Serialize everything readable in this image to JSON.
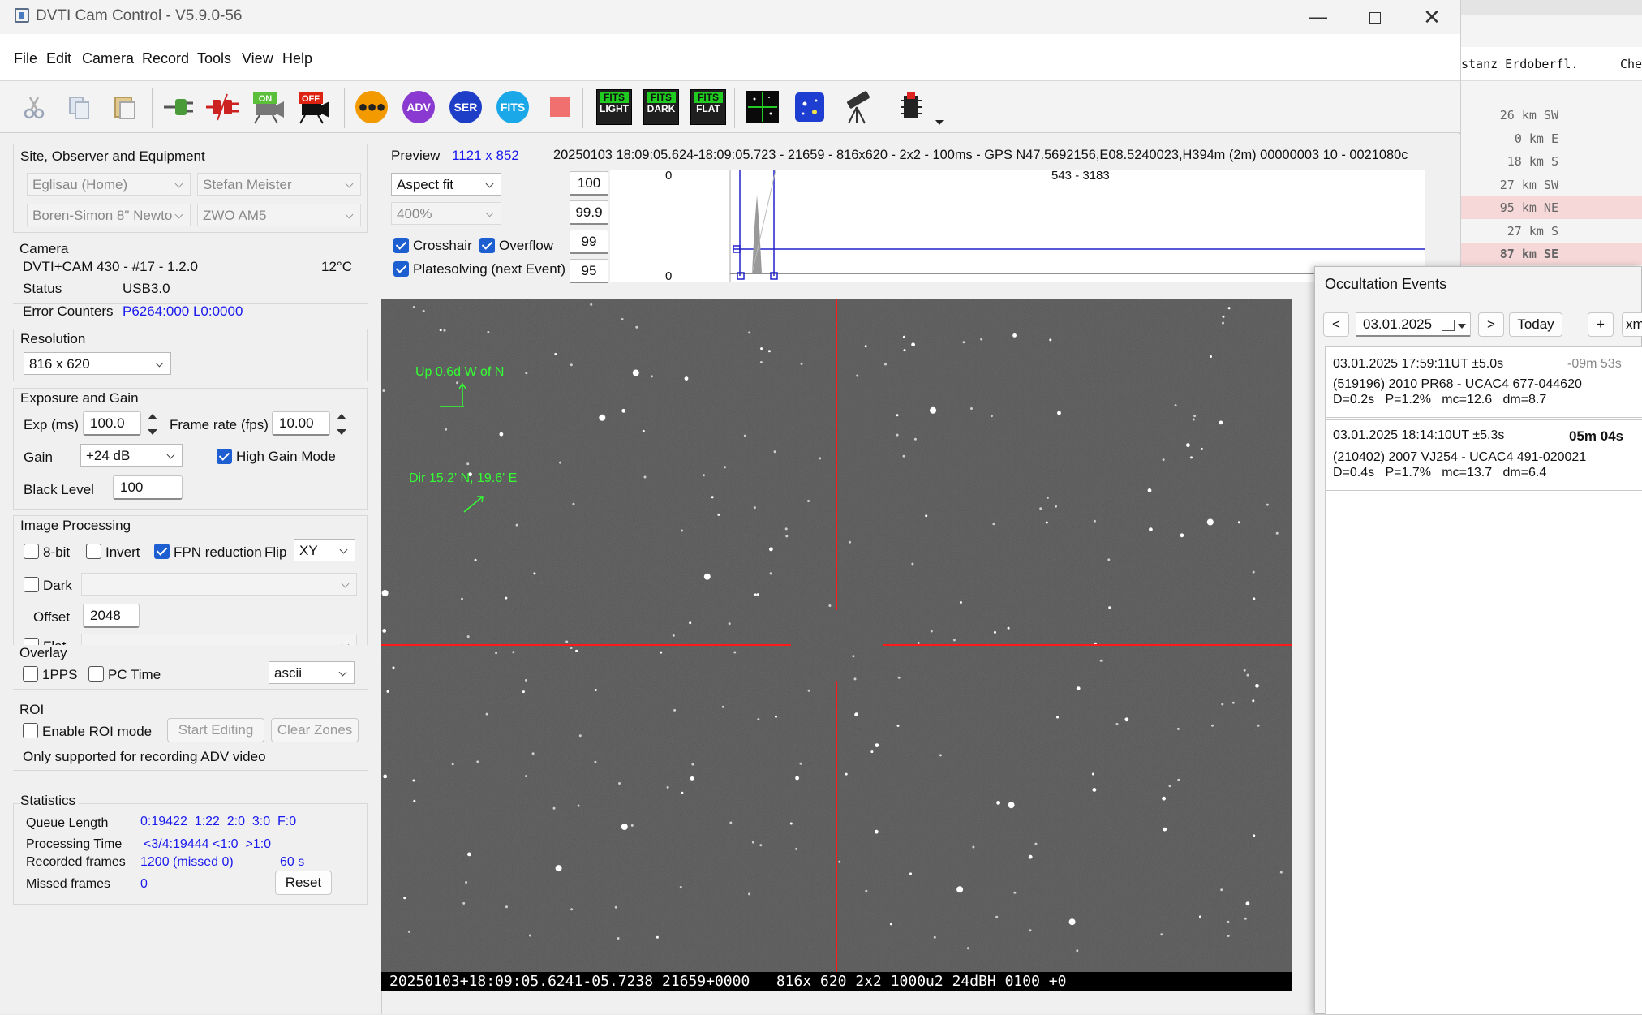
{
  "window": {
    "title": "DVTI Cam Control - V5.9.0-56"
  },
  "menu": [
    "File",
    "Edit",
    "Camera",
    "Record",
    "Tools",
    "View",
    "Help"
  ],
  "toolbar": {
    "adv": "ADV",
    "ser": "SER",
    "fits": "FITS",
    "on": "ON",
    "off": "OFF",
    "fits_light": [
      "FITS",
      "LIGHT"
    ],
    "fits_dark": [
      "FITS",
      "DARK"
    ],
    "fits_flat": [
      "FITS",
      "FLAT"
    ]
  },
  "site": {
    "title": "Site, Observer and Equipment",
    "site": "Eglisau (Home)",
    "observer": "Stefan Meister",
    "telescope": "Boren-Simon 8\" Newto",
    "camera_model": "ZWO AM5"
  },
  "camera": {
    "title": "Camera",
    "model": "DVTI+CAM 430  -  #17  -  1.2.0",
    "temp": "12°C",
    "status_label": "Status",
    "status": "USB3.0",
    "err_label": "Error Counters",
    "errors": "P6264:000 L0:0000"
  },
  "resolution": {
    "title": "Resolution",
    "value": "816 x 620"
  },
  "exposure": {
    "title": "Exposure and Gain",
    "exp_label": "Exp (ms)",
    "exp": "100.0",
    "fps_label": "Frame rate (fps)",
    "fps": "10.00",
    "gain_label": "Gain",
    "gain": "+24 dB",
    "high_gain": "High Gain Mode",
    "black_label": "Black Level",
    "black": "100"
  },
  "imgproc": {
    "title": "Image Processing",
    "bit8": "8-bit",
    "invert": "Invert",
    "fpn": "FPN reduction",
    "flip_label": "Flip",
    "flip": "XY",
    "dark": "Dark",
    "offset_label": "Offset",
    "offset": "2048",
    "flat": "Flat"
  },
  "overlay": {
    "title": "Overlay",
    "pps": "1PPS",
    "pctime": "PC Time",
    "mode": "ascii"
  },
  "roi": {
    "title": "ROI",
    "enable": "Enable ROI mode",
    "start": "Start Editing",
    "clear": "Clear Zones",
    "note": "Only supported for recording ADV video"
  },
  "stats": {
    "title": "Statistics",
    "queue_label": "Queue Length",
    "queue": "0:19422  1:22  2:0  3:0  F:0",
    "proc_label": "Processing Time",
    "proc": "<3/4:19444 <1:0  >1:0",
    "rec_label": "Recorded frames",
    "rec": "1200 (missed 0)",
    "rec_time": "60 s",
    "missed_label": "Missed frames",
    "missed": "0",
    "reset": "Reset"
  },
  "preview": {
    "label": "Preview",
    "size": "1121 x 852",
    "info": "20250103 18:09:05.624-18:09:05.723 - 21659 - 816x620 - 2x2 - 100ms - GPS N47.5692156,E08.5240023,H394m (2m) 00000003 10 - 0021080c",
    "fit": "Aspect fit",
    "zoom": "400%",
    "v1": "100",
    "v2": "99.9",
    "v3": "99",
    "v4": "95",
    "crosshair": "Crosshair",
    "overflow": "Overflow",
    "platesolving": "Platesolving (next Event)",
    "hist_top": "0",
    "hist_bottom": "0",
    "hist_range": "543 - 3183"
  },
  "image": {
    "up": "Up 0.6d W of N",
    "dir": "Dir 15.2' N, 19.6' E",
    "footer": "20250103+18:09:05.6241-05.7238 21659+0000   816x 620 2x2 1000u2 24dBH 0100 +0"
  },
  "occ": {
    "title": "Occultation Events",
    "prev": "<",
    "date": "03.01.2025",
    "next": ">",
    "today": "Today",
    "plus": "+",
    "xm": "xm",
    "events": [
      {
        "time": "03.01.2025 17:59:11UT ±5.0s",
        "countdown": "-09m 53s",
        "name": "(519196) 2010 PR68 - UCAC4 677-044620",
        "details": "D=0.2s   P=1.2%   mc=12.6   dm=8.7"
      },
      {
        "time": "03.01.2025 18:14:10UT ±5.3s",
        "countdown": "05m 04s",
        "name": "(210402) 2007 VJ254 - UCAC4 491-020021",
        "details": "D=0.4s   P=1.7%   mc=13.7   dm=6.4"
      }
    ]
  },
  "bg": {
    "hdr1": "stanz Erdoberfl.",
    "hdr2": "Che",
    "rows": [
      {
        "t": "26 km SW",
        "hl": false
      },
      {
        "t": "0 km E",
        "hl": false
      },
      {
        "t": "18 km S",
        "hl": false
      },
      {
        "t": "27 km SW",
        "hl": false
      },
      {
        "t": "95 km NE",
        "hl": true
      },
      {
        "t": "27 km S",
        "hl": false
      },
      {
        "t": "87 km SE",
        "hl": true
      }
    ]
  },
  "colors": {
    "accent": "#1d5fd0",
    "crosshair": "#ff1a1a",
    "annot": "#33ff33"
  }
}
